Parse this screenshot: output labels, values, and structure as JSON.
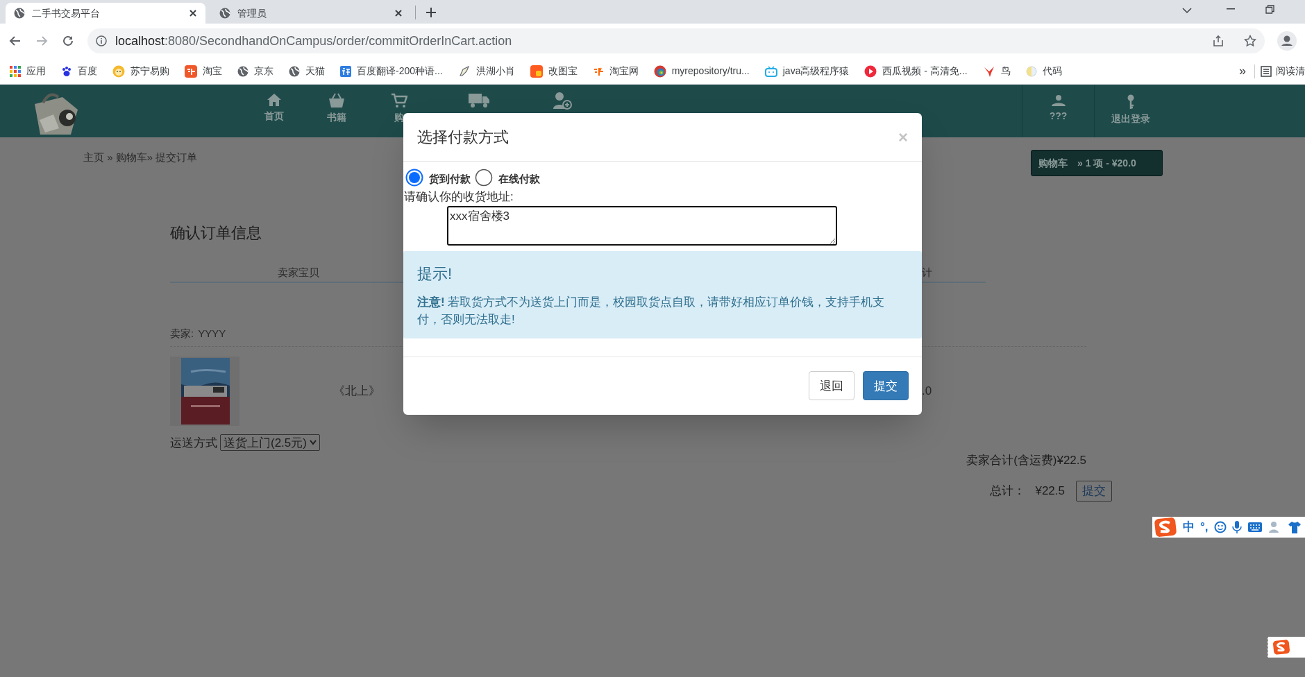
{
  "browser": {
    "tabs": [
      {
        "label": "二手书交易平台",
        "selected": true
      },
      {
        "label": "管理员",
        "selected": false
      }
    ],
    "url": {
      "host": "localhost",
      "path": ":8080/SecondhandOnCampus/order/commitOrderInCart.action"
    },
    "bookmarks": [
      "应用",
      "百度",
      "苏宁易购",
      "淘宝",
      "京东",
      "天猫",
      "百度翻译-200种语...",
      "洪湖小肖",
      "改图宝",
      "淘宝网",
      "myrepository/tru...",
      "java高级程序猿",
      "西瓜视频 - 高清免...",
      "鸟",
      "代码"
    ],
    "more_bookmarks": "»",
    "reading_list": "阅读清"
  },
  "nav": {
    "items": [
      "首页",
      "书籍",
      "购"
    ],
    "right_items": [
      "???",
      "退出登录"
    ]
  },
  "breadcrumb": "主页 » 购物车» 提交订单",
  "cart": {
    "label": "购物车",
    "detail": "» 1 项 - ¥20.0"
  },
  "order": {
    "heading": "确认订单信息",
    "columns": [
      "卖家宝贝",
      "计"
    ],
    "seller_label": "卖家:",
    "seller": "YYYY",
    "item": {
      "title": "《北上》",
      "price": ".0"
    },
    "shipping_label": "运送方式",
    "shipping": "送货上门(2.5元)",
    "seller_total": "卖家合计(含运费)¥22.5",
    "total_label": "总计：",
    "total": "¥22.5",
    "submit": "提交"
  },
  "modal": {
    "title": "选择付款方式",
    "close": "×",
    "payment_options": [
      {
        "label": "货到付款",
        "selected": true
      },
      {
        "label": "在线付款",
        "selected": false
      }
    ],
    "address_label": "请确认你的收货地址:",
    "address": "xxx宿舍楼3",
    "alert": {
      "title": "提示!",
      "text": "**注意!** 若取货方式不为送货上门而是，校园取货点自取，请带好相应订单价钱，支持手机支付，否则无法取走!"
    },
    "buttons": [
      {
        "label": "退回",
        "kind": "default"
      },
      {
        "label": "提交",
        "kind": "primary"
      }
    ]
  },
  "ime": {
    "mode": "中",
    "punctuation": "°,"
  }
}
